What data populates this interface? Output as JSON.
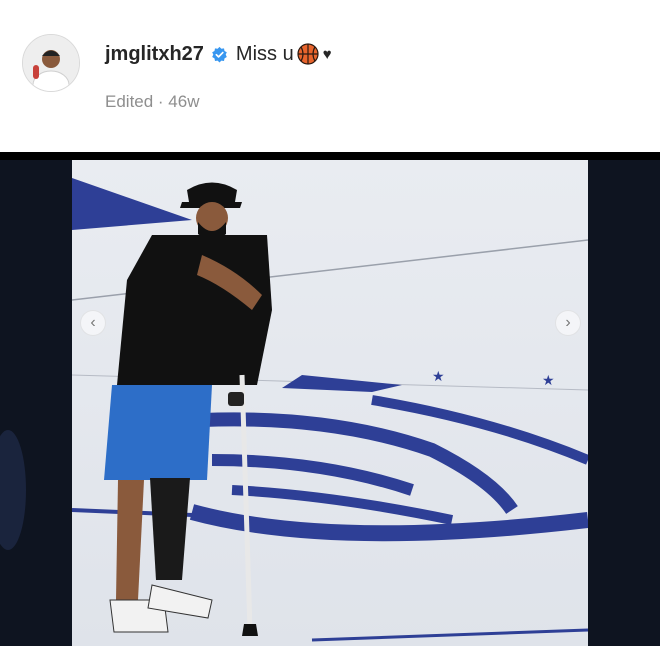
{
  "post": {
    "username": "jmglitxh27",
    "caption_text": "Miss u",
    "meta": "Edited · 46w"
  },
  "icons": {
    "verified": "verified-badge-icon",
    "caption_emoji_1": "basketball-emoji",
    "caption_emoji_2": "black-heart-emoji",
    "prev": "chevron-left-icon",
    "next": "chevron-right-icon"
  },
  "glyphs": {
    "heart": "♥",
    "prev": "‹",
    "next": "›"
  },
  "colors": {
    "verified_blue": "#3897f0",
    "court_blue": "#2e3f96",
    "jersey_blue": "#2d6ec8",
    "panel_dark": "#0e1420"
  }
}
